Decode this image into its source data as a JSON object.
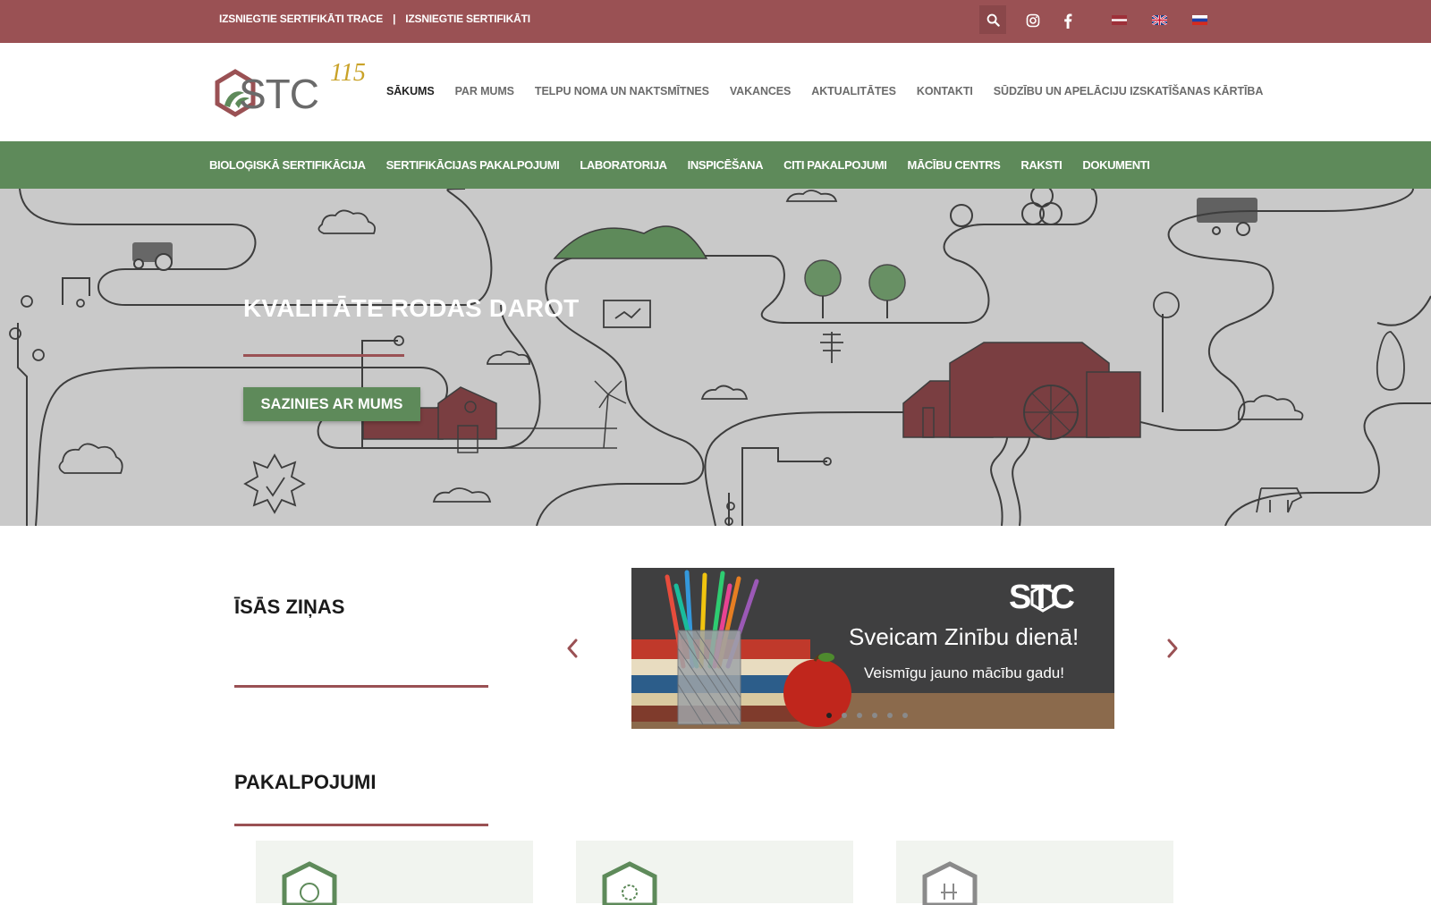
{
  "topbar": {
    "link1": "IZSNIEGTIE SERTIFIKĀTI TRACE",
    "separator": "|",
    "link2": "IZSNIEGTIE SERTIFIKĀTI",
    "icons": [
      "search-icon",
      "instagram-icon",
      "facebook-icon"
    ],
    "languages": [
      "latvian-flag",
      "english-flag",
      "russian-flag"
    ]
  },
  "header": {
    "logo_text": "STC",
    "logo_badge": "115",
    "nav": [
      "SĀKUMS",
      "PAR MUMS",
      "TELPU NOMA UN NAKTSMĪTNES",
      "VAKANCES",
      "AKTUALITĀTES",
      "KONTAKTI",
      "SŪDZĪBU UN APELĀCIJU IZSKATĪŠANAS KĀRTĪBA"
    ],
    "active": "SĀKUMS"
  },
  "greennav": [
    "BIOLOĢISKĀ SERTIFIKĀCIJA",
    "SERTIFIKĀCIJAS PAKALPOJUMI",
    "LABORATORIJA",
    "INSPICĒŠANA",
    "CITI PAKALPOJUMI",
    "MĀCĪBU CENTRS",
    "RAKSTI",
    "DOKUMENTI"
  ],
  "hero": {
    "title": "KVALITĀTE RODAS DAROT",
    "button": "SAZINIES AR MUMS"
  },
  "news": {
    "title": "ĪSĀS ZIŅAS",
    "slide": {
      "brand": "STC",
      "greeting": "Sveicam Zinību dienā!",
      "wish": "Veismīgu jauno mācību gadu!"
    },
    "dots_count": 6,
    "active_dot": 1
  },
  "services": {
    "title": "PAKALPOJUMI"
  },
  "colors": {
    "brand_red": "#9a5154",
    "brand_green": "#5e8a5a",
    "hero_bg": "#c9c9c9"
  }
}
